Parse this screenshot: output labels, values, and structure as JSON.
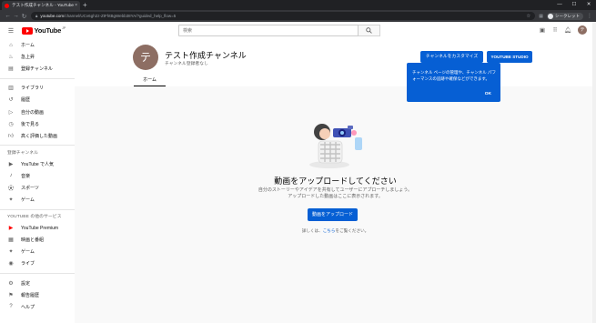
{
  "browser": {
    "tab_title": "テスト作成チャンネル - YouTube",
    "tab_close": "×",
    "new_tab": "+",
    "win_minimize": "—",
    "win_maximize": "☐",
    "win_close": "✕",
    "url_host": "youtube.com",
    "url_path": "/channel/UCv6gh2z-ZtFhtBgWebb38YA/?guided_help_flow=5",
    "profile_label": "シークレット"
  },
  "masthead": {
    "logo_text": "YouTube",
    "logo_region": "JP",
    "search_placeholder": "検索",
    "avatar_letter": "テ"
  },
  "sidebar": {
    "section1": [
      {
        "label": "ホーム",
        "icon": "home-icon"
      },
      {
        "label": "急上昇",
        "icon": "trending-icon"
      },
      {
        "label": "登録チャンネル",
        "icon": "subscriptions-icon"
      }
    ],
    "section2": [
      {
        "label": "ライブラリ",
        "icon": "library-icon"
      },
      {
        "label": "履歴",
        "icon": "history-icon"
      },
      {
        "label": "自分の動画",
        "icon": "your-videos-icon"
      },
      {
        "label": "後で見る",
        "icon": "watch-later-icon"
      },
      {
        "label": "高く評価した動画",
        "icon": "liked-icon"
      }
    ],
    "subs_heading": "登録チャンネル",
    "section3": [
      {
        "label": "YouTube で人気",
        "icon": "popular-icon"
      },
      {
        "label": "音楽",
        "icon": "music-icon"
      },
      {
        "label": "スポーツ",
        "icon": "sports-icon"
      },
      {
        "label": "ゲーム",
        "icon": "gaming-icon"
      }
    ],
    "more_heading": "YOUTUBE の他のサービス",
    "section4": [
      {
        "label": "YouTube Premium",
        "icon": "premium-icon"
      },
      {
        "label": "映画と番組",
        "icon": "movies-icon"
      },
      {
        "label": "ゲーム",
        "icon": "gaming-icon"
      },
      {
        "label": "ライブ",
        "icon": "live-icon"
      }
    ],
    "section5": [
      {
        "label": "設定",
        "icon": "settings-icon"
      },
      {
        "label": "報告履歴",
        "icon": "flag-icon"
      },
      {
        "label": "ヘルプ",
        "icon": "help-icon"
      }
    ]
  },
  "channel": {
    "avatar_letter": "テ",
    "name": "テスト作成チャンネル",
    "subscribers": "チャンネル登録者なし",
    "customize_label": "チャンネルをカスタマイズ",
    "studio_label": "YOUTUBE STUDIO",
    "tab_home": "ホーム"
  },
  "tooltip": {
    "text": "チャンネル ページの管理や、チャンネル パフォーマンスの追跡や確保などができます。",
    "ok": "OK"
  },
  "empty_state": {
    "title": "動画をアップロードしてください",
    "desc_line1": "自分のストーリーやアイデアを共有してユーザーにアプローチしましょう。",
    "desc_line2": "アップロードした動画はここに表示されます。",
    "upload_button": "動画をアップロード",
    "help_prefix": "詳しくは、",
    "help_link": "こちら",
    "help_suffix": "をご覧ください。"
  },
  "colors": {
    "accent": "#065fd4",
    "youtube_red": "#ff0000",
    "avatar": "#8d6e63"
  }
}
